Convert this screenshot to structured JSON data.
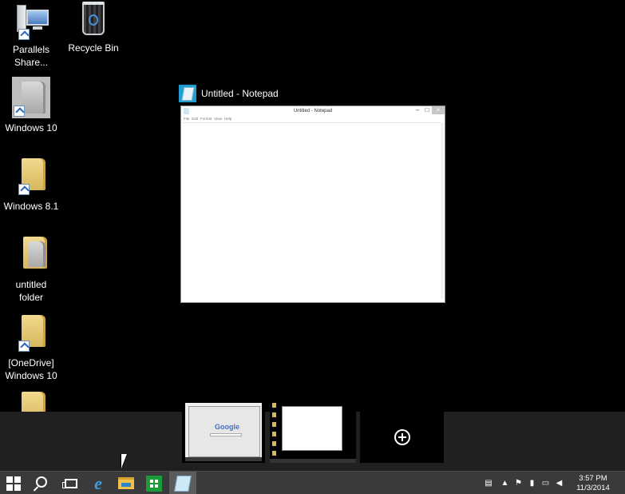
{
  "desktop": {
    "icons": [
      {
        "label": "Parallels Share...",
        "icon": "parallels-share-icon"
      },
      {
        "label": "Recycle Bin",
        "icon": "recycle-bin-icon"
      },
      {
        "label": "Windows 10",
        "icon": "folder-shortcut-icon"
      },
      {
        "label": "Windows 8.1",
        "icon": "folder-shortcut-icon"
      },
      {
        "label": "untitled folder",
        "icon": "folder-icon"
      },
      {
        "label": "[OneDrive] Windows 10",
        "icon": "folder-shortcut-icon"
      }
    ]
  },
  "task_view": {
    "window_title": "Untitled - Notepad",
    "notepad_thumb": {
      "title": "Untitled - Notepad",
      "menu": [
        "File",
        "Edit",
        "Format",
        "View",
        "Help"
      ]
    },
    "desktops_thumb_google_text": "Google",
    "add_desktop_icon": "plus-circle-icon"
  },
  "taskbar": {
    "buttons": [
      {
        "name": "start-button",
        "icon": "windows-logo-icon"
      },
      {
        "name": "search-button",
        "icon": "search-icon"
      },
      {
        "name": "task-view-button",
        "icon": "task-view-icon"
      },
      {
        "name": "internet-explorer-button",
        "icon": "internet-explorer-icon"
      },
      {
        "name": "file-explorer-button",
        "icon": "file-explorer-icon"
      },
      {
        "name": "store-button",
        "icon": "store-icon"
      },
      {
        "name": "notepad-button",
        "icon": "notepad-icon",
        "active": true
      }
    ],
    "tray": {
      "icons": [
        "notifications-icon",
        "show-hidden-icons-icon",
        "action-center-flag-icon",
        "power-icon",
        "network-icon",
        "volume-icon"
      ],
      "time": "3:57 PM",
      "date": "11/3/2014"
    }
  }
}
